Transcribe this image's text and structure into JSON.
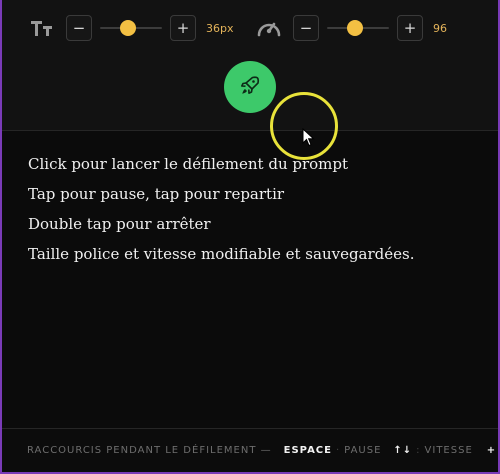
{
  "toolbar": {
    "font_size": {
      "icon": "text-size-icon",
      "minus_label": "−",
      "plus_label": "+",
      "value": "36px",
      "level": 0.45
    },
    "speed": {
      "icon": "speedometer-icon",
      "minus_label": "−",
      "plus_label": "+",
      "value": "96",
      "level": 0.45
    },
    "launch_icon": "rocket-icon"
  },
  "prompt": {
    "lines": [
      "Click pour lancer le défilement du prompt",
      "Tap pour pause, tap pour repartir",
      "Double tap pour arrêter",
      "Taille police et vitesse modifiable et sauvegardées."
    ]
  },
  "footer": {
    "label": "RACCOURCIS PENDANT LE DÉFILEMENT —",
    "space_key": "ESPACE",
    "space_action": "PAUSE",
    "arrows_key": "↑↓",
    "arrows_action": "VITESSE",
    "trailing": "+"
  },
  "colors": {
    "accent_yellow": "#f3c043",
    "launch_green": "#3dc96a",
    "value_text": "#e3b35a",
    "frame_purple": "#7a3bb8"
  }
}
